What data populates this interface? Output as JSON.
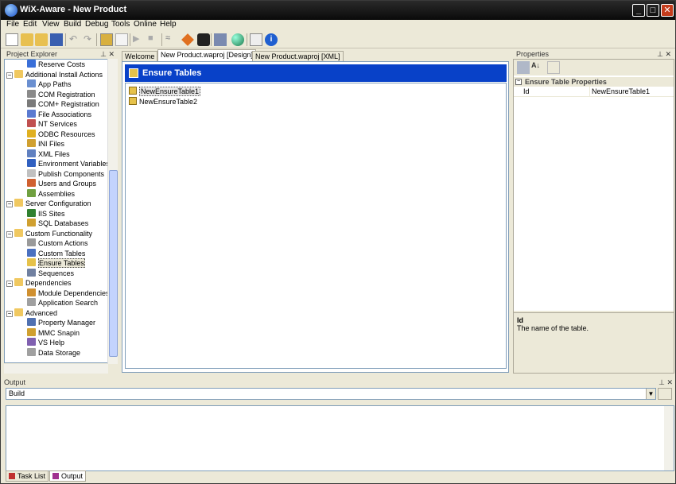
{
  "window": {
    "title": "WiX-Aware - New Product",
    "minimize": "_",
    "maximize": "□",
    "close": "✕"
  },
  "menu": [
    "File",
    "Edit",
    "View",
    "Build",
    "Debug",
    "Tools",
    "Online",
    "Help"
  ],
  "explorer": {
    "title": "Project Explorer",
    "items": [
      {
        "label": "Reserve Costs",
        "level": 2,
        "icon": "reserve-costs-icon",
        "color": "#3a6fd8"
      },
      {
        "label": "Additional Install Actions",
        "level": 1,
        "icon": "folder-icon",
        "color": "#f0c860",
        "expander": "−"
      },
      {
        "label": "App Paths",
        "level": 2,
        "icon": "app-paths-icon",
        "color": "#6a8fd0"
      },
      {
        "label": "COM Registration",
        "level": 2,
        "icon": "com-registration-icon",
        "color": "#8a8a8a"
      },
      {
        "label": "COM+ Registration",
        "level": 2,
        "icon": "com-plus-registration-icon",
        "color": "#7a7a7a"
      },
      {
        "label": "File Associations",
        "level": 2,
        "icon": "file-associations-icon",
        "color": "#5a7ad0"
      },
      {
        "label": "NT Services",
        "level": 2,
        "icon": "nt-services-icon",
        "color": "#c05050"
      },
      {
        "label": "ODBC Resources",
        "level": 2,
        "icon": "odbc-resources-icon",
        "color": "#e0b020"
      },
      {
        "label": "INI Files",
        "level": 2,
        "icon": "ini-files-icon",
        "color": "#d0a030"
      },
      {
        "label": "XML Files",
        "level": 2,
        "icon": "xml-files-icon",
        "color": "#6080c0"
      },
      {
        "label": "Environment Variables",
        "level": 2,
        "icon": "environment-variables-icon",
        "color": "#3060c0"
      },
      {
        "label": "Publish Components",
        "level": 2,
        "icon": "publish-components-icon",
        "color": "#c0c0c0"
      },
      {
        "label": "Users and Groups",
        "level": 2,
        "icon": "users-groups-icon",
        "color": "#d06030"
      },
      {
        "label": "Assemblies",
        "level": 2,
        "icon": "assemblies-icon",
        "color": "#70a040"
      },
      {
        "label": "Server Configuration",
        "level": 1,
        "icon": "folder-icon",
        "color": "#f0c860",
        "expander": "−"
      },
      {
        "label": "IIS Sites",
        "level": 2,
        "icon": "iis-sites-icon",
        "color": "#308030"
      },
      {
        "label": "SQL Databases",
        "level": 2,
        "icon": "sql-databases-icon",
        "color": "#d0a030"
      },
      {
        "label": "Custom Functionality",
        "level": 1,
        "icon": "folder-icon",
        "color": "#f0c860",
        "expander": "−"
      },
      {
        "label": "Custom Actions",
        "level": 2,
        "icon": "custom-actions-icon",
        "color": "#9a9a9a"
      },
      {
        "label": "Custom Tables",
        "level": 2,
        "icon": "custom-tables-icon",
        "color": "#4a70c0"
      },
      {
        "label": "Ensure Tables",
        "level": 2,
        "icon": "ensure-tables-icon",
        "color": "#e6c24a",
        "selected": true
      },
      {
        "label": "Sequences",
        "level": 2,
        "icon": "sequences-icon",
        "color": "#7080a0"
      },
      {
        "label": "Dependencies",
        "level": 1,
        "icon": "folder-icon",
        "color": "#f0c860",
        "expander": "−"
      },
      {
        "label": "Module Dependencies",
        "level": 2,
        "icon": "module-dependencies-icon",
        "color": "#d09030"
      },
      {
        "label": "Application Search",
        "level": 2,
        "icon": "application-search-icon",
        "color": "#a0a0a0"
      },
      {
        "label": "Advanced",
        "level": 1,
        "icon": "folder-icon",
        "color": "#f0c860",
        "expander": "−"
      },
      {
        "label": "Property Manager",
        "level": 2,
        "icon": "property-manager-icon",
        "color": "#5070b0"
      },
      {
        "label": "MMC Snapin",
        "level": 2,
        "icon": "mmc-snapin-icon",
        "color": "#d0a030"
      },
      {
        "label": "VS Help",
        "level": 2,
        "icon": "vs-help-icon",
        "color": "#8060b0"
      },
      {
        "label": "Data Storage",
        "level": 2,
        "icon": "data-storage-icon",
        "color": "#a0a0a0"
      }
    ]
  },
  "tabs": [
    {
      "label": "Welcome",
      "active": false
    },
    {
      "label": "New Product.waproj [Design]",
      "active": true
    },
    {
      "label": "New Product.waproj [XML]",
      "active": false
    }
  ],
  "document": {
    "header": "Ensure Tables",
    "items": [
      "NewEnsureTable1",
      "NewEnsureTable2"
    ]
  },
  "properties": {
    "title": "Properties",
    "category": "Ensure Table Properties",
    "row": {
      "key": "Id",
      "value": "NewEnsureTable1"
    },
    "description_title": "Id",
    "description_text": "The name of the table."
  },
  "output": {
    "title": "Output",
    "selected": "Build"
  },
  "bottom_tabs": [
    "Task List",
    "Output"
  ]
}
